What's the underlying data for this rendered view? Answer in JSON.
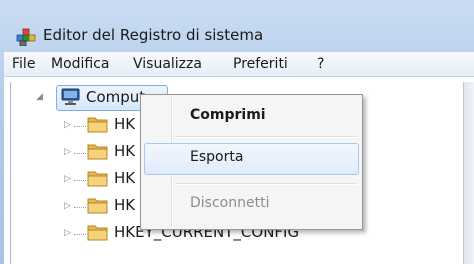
{
  "window": {
    "title": "Editor del Registro di sistema",
    "icon": "registry-editor-icon"
  },
  "menubar": {
    "items": [
      "File",
      "Modifica",
      "Visualizza",
      "Preferiti",
      "?"
    ]
  },
  "tree": {
    "root": {
      "label": "Computer",
      "visible_label": "Comput",
      "icon": "computer-icon",
      "expanded": true
    },
    "children": [
      {
        "label": "HK",
        "icon": "folder-icon"
      },
      {
        "label": "HK",
        "icon": "folder-icon"
      },
      {
        "label": "HK",
        "icon": "folder-icon"
      },
      {
        "label": "HK",
        "icon": "folder-icon"
      },
      {
        "label": "HKEY_CURRENT_CONFIG",
        "icon": "folder-icon"
      }
    ]
  },
  "context_menu": {
    "items": [
      {
        "label": "Comprimi",
        "bold": true,
        "state": "normal"
      },
      {
        "label": "Esporta",
        "bold": false,
        "state": "hover"
      },
      {
        "label": "Disconnetti",
        "bold": false,
        "state": "disabled"
      }
    ]
  }
}
